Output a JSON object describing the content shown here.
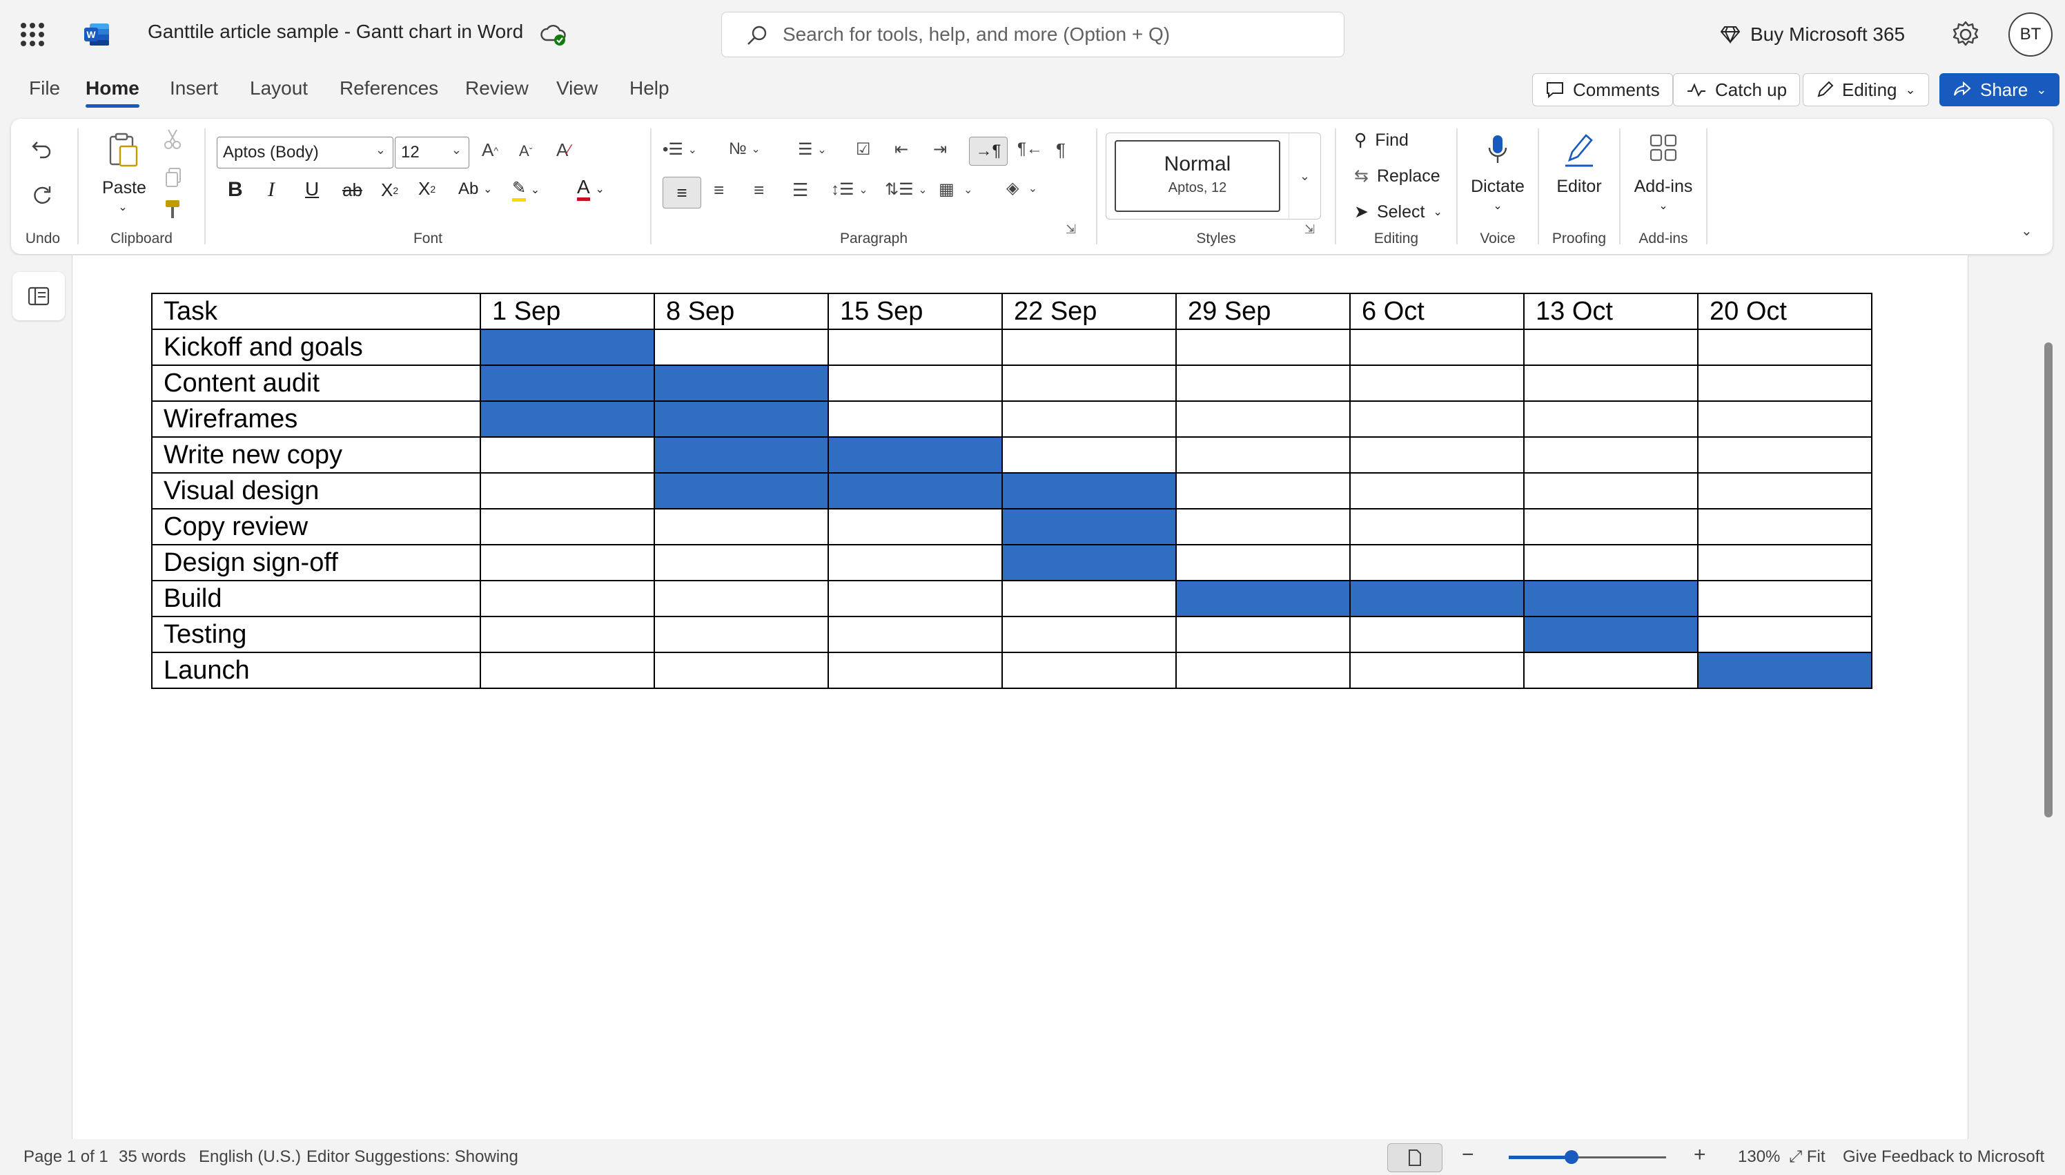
{
  "app": {
    "document_title": "Ganttile article sample - Gantt chart in Word",
    "search_placeholder": "Search for tools, help, and more (Option + Q)",
    "buy_label": "Buy Microsoft 365",
    "avatar_initials": "BT",
    "accent_color": "#185abd",
    "bar_color": "#2f6ec0"
  },
  "menu": {
    "tabs": [
      "File",
      "Home",
      "Insert",
      "Layout",
      "References",
      "Review",
      "View",
      "Help"
    ],
    "active_tab": "Home",
    "comments_label": "Comments",
    "catchup_label": "Catch up",
    "editing_label": "Editing",
    "share_label": "Share"
  },
  "ribbon": {
    "undo_group_label": "Undo",
    "paste_label": "Paste",
    "clipboard_group_label": "Clipboard",
    "font_name": "Aptos (Body)",
    "font_size": "12",
    "font_group_label": "Font",
    "paragraph_group_label": "Paragraph",
    "style_name": "Normal",
    "style_sub": "Aptos, 12",
    "styles_group_label": "Styles",
    "find_label": "Find",
    "replace_label": "Replace",
    "select_label": "Select",
    "editing_group_label": "Editing",
    "dictate_label": "Dictate",
    "voice_group_label": "Voice",
    "editor_label": "Editor",
    "proofing_group_label": "Proofing",
    "addins_label": "Add-ins",
    "addins_group_label": "Add-ins"
  },
  "gantt": {
    "header": [
      "Task",
      "1 Sep",
      "8 Sep",
      "15 Sep",
      "22 Sep",
      "29 Sep",
      "6 Oct",
      "13 Oct",
      "20 Oct"
    ],
    "rows": [
      {
        "task": "Kickoff and goals",
        "weeks": [
          1,
          0,
          0,
          0,
          0,
          0,
          0,
          0
        ]
      },
      {
        "task": "Content audit",
        "weeks": [
          1,
          1,
          0,
          0,
          0,
          0,
          0,
          0
        ]
      },
      {
        "task": "Wireframes",
        "weeks": [
          1,
          1,
          0,
          0,
          0,
          0,
          0,
          0
        ]
      },
      {
        "task": "Write new copy",
        "weeks": [
          0,
          1,
          1,
          0,
          0,
          0,
          0,
          0
        ]
      },
      {
        "task": "Visual design",
        "weeks": [
          0,
          1,
          1,
          1,
          0,
          0,
          0,
          0
        ]
      },
      {
        "task": "Copy review",
        "weeks": [
          0,
          0,
          0,
          1,
          0,
          0,
          0,
          0
        ]
      },
      {
        "task": "Design sign-off",
        "weeks": [
          0,
          0,
          0,
          1,
          0,
          0,
          0,
          0
        ]
      },
      {
        "task": "Build",
        "weeks": [
          0,
          0,
          0,
          0,
          1,
          1,
          1,
          0
        ]
      },
      {
        "task": "Testing",
        "weeks": [
          0,
          0,
          0,
          0,
          0,
          0,
          1,
          0
        ]
      },
      {
        "task": "Launch",
        "weeks": [
          0,
          0,
          0,
          0,
          0,
          0,
          0,
          1
        ]
      }
    ]
  },
  "status": {
    "page": "Page 1 of 1",
    "words": "35 words",
    "language": "English (U.S.)",
    "editor": "Editor Suggestions: Showing",
    "zoom": "130%",
    "zoom_level": 0.4,
    "fit": "Fit",
    "feedback": "Give Feedback to Microsoft"
  }
}
